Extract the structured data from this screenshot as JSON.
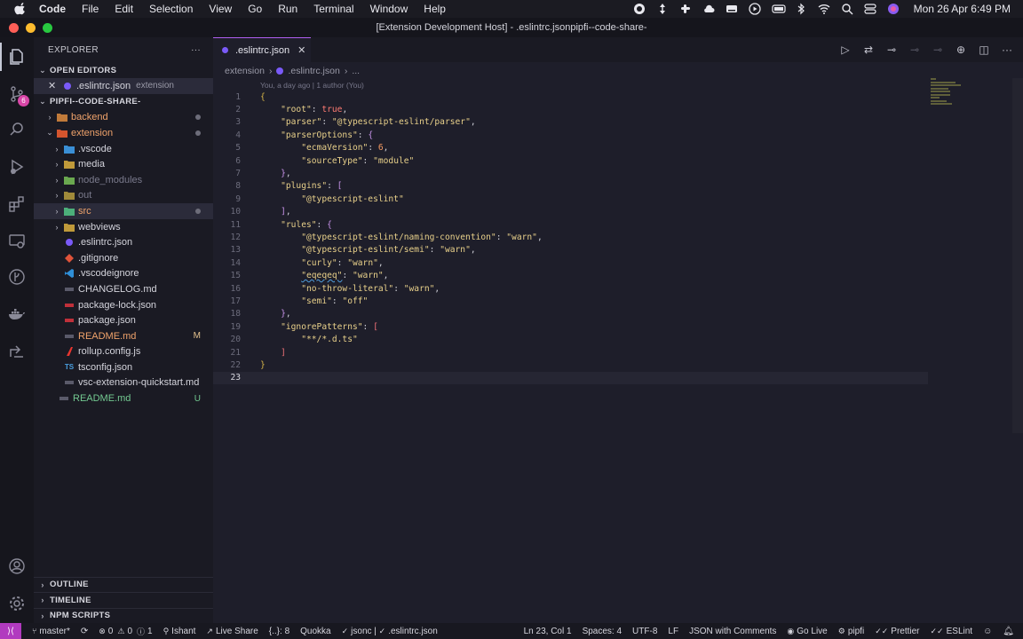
{
  "menubar": {
    "items": [
      "Code",
      "File",
      "Edit",
      "Selection",
      "View",
      "Go",
      "Run",
      "Terminal",
      "Window",
      "Help"
    ],
    "clock": "Mon 26 Apr  6:49 PM"
  },
  "window": {
    "title": "[Extension Development Host] - .eslintrc.jsonpipfi--code-share-"
  },
  "activity": {
    "scm_badge": "6"
  },
  "sidebar": {
    "header": "EXPLORER",
    "more": "···",
    "open_editors_title": "OPEN EDITORS",
    "open_editor": {
      "name": ".eslintrc.json",
      "desc": "extension"
    },
    "project_title": "PIPFI--CODE-SHARE-",
    "tree": [
      {
        "label": "backend",
        "color": "#f0a36b"
      },
      {
        "label": "extension",
        "color": "#f0a36b"
      },
      {
        "label": ".vscode",
        "color": "#d4d4dc"
      },
      {
        "label": "media",
        "color": "#d4d4dc"
      },
      {
        "label": "node_modules",
        "color": "#7a7a8c"
      },
      {
        "label": "out",
        "color": "#7a7a8c"
      },
      {
        "label": "src",
        "color": "#f0a36b"
      },
      {
        "label": "webviews",
        "color": "#d4d4dc"
      },
      {
        "label": ".eslintrc.json",
        "color": "#d4d4dc"
      },
      {
        "label": ".gitignore",
        "color": "#d4d4dc"
      },
      {
        "label": ".vscodeignore",
        "color": "#d4d4dc"
      },
      {
        "label": "CHANGELOG.md",
        "color": "#d4d4dc"
      },
      {
        "label": "package-lock.json",
        "color": "#d4d4dc"
      },
      {
        "label": "package.json",
        "color": "#d4d4dc"
      },
      {
        "label": "README.md",
        "color": "#f0a36b",
        "status": "M"
      },
      {
        "label": "rollup.config.js",
        "color": "#d4d4dc"
      },
      {
        "label": "tsconfig.json",
        "color": "#d4d4dc"
      },
      {
        "label": "vsc-extension-quickstart.md",
        "color": "#d4d4dc"
      },
      {
        "label": "README.md",
        "color": "#73c991",
        "status": "U"
      }
    ],
    "bottom_sections": [
      "OUTLINE",
      "TIMELINE",
      "NPM SCRIPTS"
    ]
  },
  "editor": {
    "tab_label": ".eslintrc.json",
    "breadcrumb": [
      "extension",
      ".eslintrc.json",
      "..."
    ],
    "blame": "You, a day ago | 1 author (You)",
    "lines": [
      {
        "n": "1"
      },
      {
        "n": "2"
      },
      {
        "n": "3"
      },
      {
        "n": "4"
      },
      {
        "n": "5"
      },
      {
        "n": "6"
      },
      {
        "n": "7"
      },
      {
        "n": "8"
      },
      {
        "n": "9"
      },
      {
        "n": "10"
      },
      {
        "n": "11"
      },
      {
        "n": "12"
      },
      {
        "n": "13"
      },
      {
        "n": "14"
      },
      {
        "n": "15"
      },
      {
        "n": "16"
      },
      {
        "n": "17"
      },
      {
        "n": "18"
      },
      {
        "n": "19"
      },
      {
        "n": "20"
      },
      {
        "n": "21"
      },
      {
        "n": "22"
      },
      {
        "n": "23"
      }
    ],
    "code": {
      "root_key": "\"root\"",
      "root_val": "true",
      "parser_key": "\"parser\"",
      "parser_val": "\"@typescript-eslint/parser\"",
      "po_key": "\"parserOptions\"",
      "ecma_key": "\"ecmaVersion\"",
      "ecma_val": "6",
      "st_key": "\"sourceType\"",
      "st_val": "\"module\"",
      "plugins_key": "\"plugins\"",
      "plugin_val": "\"@typescript-eslint\"",
      "rules_key": "\"rules\"",
      "r1_key": "\"@typescript-eslint/naming-convention\"",
      "r1_val": "\"warn\"",
      "r2_key": "\"@typescript-eslint/semi\"",
      "r2_val": "\"warn\"",
      "r3_key": "\"curly\"",
      "r3_val": "\"warn\"",
      "r4_key": "\"eqeqeq\"",
      "r4_val": "\"warn\"",
      "r5_key": "\"no-throw-literal\"",
      "r5_val": "\"warn\"",
      "r6_key": "\"semi\"",
      "r6_val": "\"off\"",
      "ig_key": "\"ignorePatterns\"",
      "ig_val": "\"**/*.d.ts\""
    }
  },
  "statusbar": {
    "branch": "master*",
    "errors": "0",
    "warnings": "0",
    "info": "1",
    "user": "Ishant",
    "live_share": "Live Share",
    "braces": "{..}: 8",
    "quokka": "Quokka",
    "jsonc": "jsonc |",
    "file": ".eslintrc.json",
    "position": "Ln 23, Col 1",
    "spaces": "Spaces: 4",
    "encoding": "UTF-8",
    "eol": "LF",
    "language": "JSON with Comments",
    "go_live": "Go Live",
    "pipfi": "pipfi",
    "prettier": "Prettier",
    "eslint": "ESLint"
  }
}
